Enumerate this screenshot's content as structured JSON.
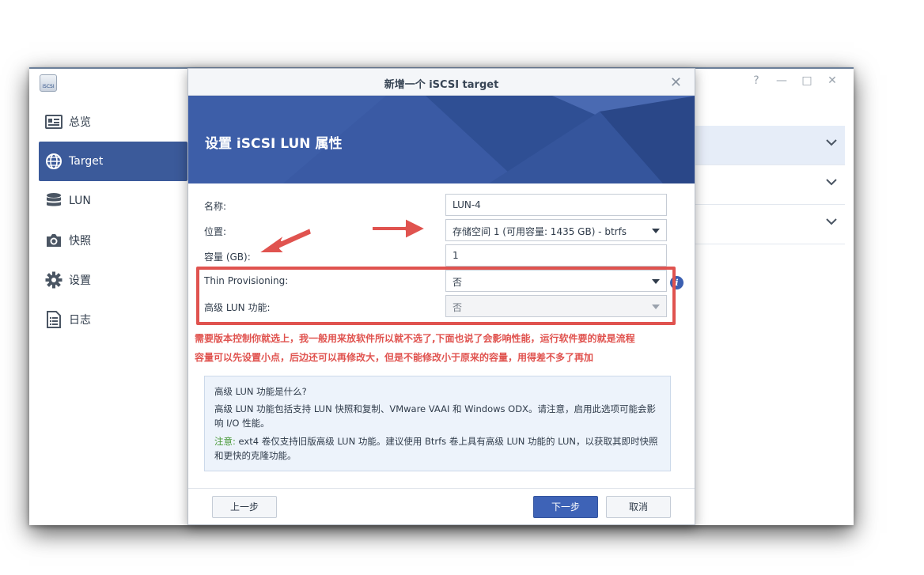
{
  "app": {
    "icon_label": "iSCSI",
    "sidebar": [
      {
        "label": "总览",
        "icon": "overview-icon",
        "active": false
      },
      {
        "label": "Target",
        "icon": "globe-icon",
        "active": true
      },
      {
        "label": "LUN",
        "icon": "database-icon",
        "active": false
      },
      {
        "label": "快照",
        "icon": "camera-icon",
        "active": false
      },
      {
        "label": "设置",
        "icon": "gear-icon",
        "active": false
      },
      {
        "label": "日志",
        "icon": "log-icon",
        "active": false
      }
    ],
    "window_controls": {
      "help": "?",
      "minimize": "—",
      "maximize": "□",
      "close": "✕"
    }
  },
  "dialog": {
    "title": "新增一个 iSCSI target",
    "close": "✕",
    "banner_title": "设置 iSCSI LUN 属性",
    "fields": {
      "name": {
        "label": "名称:",
        "value": "LUN-4"
      },
      "location": {
        "label": "位置:",
        "value": "存储空间 1 (可用容量: 1435 GB) - btrfs"
      },
      "capacity": {
        "label": "容量 (GB):",
        "value": "1"
      },
      "thin_provisioning": {
        "label": "Thin Provisioning:",
        "value": "否"
      },
      "advanced_lun": {
        "label": "高级 LUN 功能:",
        "value": "否"
      }
    },
    "info_icon": "i",
    "annotation": {
      "line1": "需要版本控制你就选上，我一般用来放软件所以就不选了,下面也说了会影响性能，运行软件要的就是流程",
      "line2": "容量可以先设置小点，后边还可以再修改大，但是不能修改小于原来的容量，用得差不多了再加",
      "color": "#e0534f"
    },
    "help": {
      "title": "高级 LUN 功能是什么?",
      "p1": "高级 LUN 功能包括支持 LUN 快照和复制、VMware VAAI 和 Windows ODX。请注意，启用此选项可能会影响 I/O 性能。",
      "note_label": "注意:",
      "p2": " ext4 卷仅支持旧版高级 LUN 功能。建议使用 Btrfs 卷上具有高级 LUN 功能的 LUN，以获取其即时快照和更快的克隆功能。"
    },
    "buttons": {
      "back": "上一步",
      "next": "下一步",
      "cancel": "取消"
    }
  },
  "colors": {
    "accent": "#3b5a9a",
    "primary_button": "#3e63b7",
    "annotation_red": "#e0534f"
  }
}
